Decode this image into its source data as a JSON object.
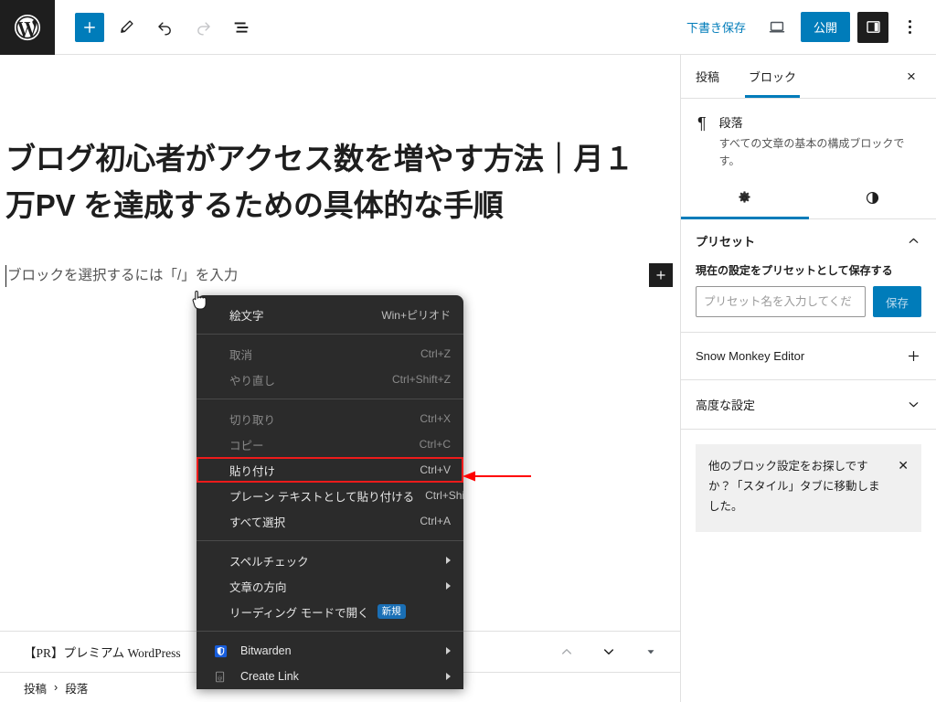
{
  "header": {
    "logo_icon": "wordpress-logo-icon",
    "left_tools": [
      {
        "name": "add-block-button",
        "icon": "plus-icon",
        "label": "ブロックを追加",
        "state": "primary"
      },
      {
        "name": "edit-tool-button",
        "icon": "pencil-icon",
        "label": "ツール",
        "state": "normal"
      },
      {
        "name": "undo-button",
        "icon": "undo-icon",
        "label": "取り消し",
        "state": "normal"
      },
      {
        "name": "redo-button",
        "icon": "redo-icon",
        "label": "やり直し",
        "state": "disabled"
      },
      {
        "name": "details-button",
        "icon": "document-overview-icon",
        "label": "詳細",
        "state": "normal"
      }
    ],
    "save_draft_label": "下書き保存",
    "preview_icon": "laptop-preview-icon",
    "publish_label": "公開",
    "sidebar_toggle_icon": "sidebar-panel-icon",
    "options_icon": "vertical-dots-icon"
  },
  "editor": {
    "post_title": "ブログ初心者がアクセス数を増やす方法｜月１万PV を達成するための具体的な手順",
    "paragraph_placeholder": "ブロックを選択するには「/」を入力",
    "appender_icon": "plus-icon"
  },
  "bottom_bar": {
    "note": "【PR】プレミアム WordPress",
    "arrows": [
      {
        "name": "move-up-button",
        "icon": "chevron-up-icon"
      },
      {
        "name": "move-down-button",
        "icon": "chevron-down-icon"
      },
      {
        "name": "more-options-button",
        "icon": "caret-down-icon"
      }
    ],
    "breadcrumb": [
      "投稿",
      "段落"
    ],
    "breadcrumb_separator": "›"
  },
  "sidebar": {
    "tabs": [
      {
        "label": "投稿",
        "active": false
      },
      {
        "label": "ブロック",
        "active": true
      }
    ],
    "close_icon": "close-icon",
    "close_label": "×",
    "block_card": {
      "icon": "paragraph-pilcrow-icon",
      "icon_glyph": "¶",
      "title": "段落",
      "description": "すべての文章の基本の構成ブロックです。"
    },
    "icon_tabs": [
      {
        "name": "settings-tab",
        "icon": "gear-icon",
        "active": true
      },
      {
        "name": "styles-tab",
        "icon": "contrast-icon",
        "active": false
      }
    ],
    "preset_panel": {
      "title": "プリセット",
      "chevron": "chevron-up-icon",
      "field_label": "現在の設定をプリセットとして保存する",
      "input_placeholder": "プリセット名を入力してくだ",
      "input_value": "",
      "save_label": "保存"
    },
    "snow_monkey_panel": {
      "title": "Snow Monkey Editor",
      "icon": "plus-icon"
    },
    "advanced_panel": {
      "title": "高度な設定",
      "chevron": "chevron-down-icon"
    },
    "notice": {
      "text": "他のブロック設定をお探しですか？「スタイル」タブに移動しました。",
      "close_icon": "close-icon",
      "close_label": "✕"
    }
  },
  "context_menu": {
    "groups": [
      {
        "items": [
          {
            "label": "絵文字",
            "accel": "Win+ピリオド",
            "state": "normal",
            "name": "menu-item-emoji"
          }
        ]
      },
      {
        "items": [
          {
            "label": "取消",
            "accel": "Ctrl+Z",
            "state": "disabled",
            "name": "menu-item-undo"
          },
          {
            "label": "やり直し",
            "accel": "Ctrl+Shift+Z",
            "state": "disabled",
            "name": "menu-item-redo"
          }
        ]
      },
      {
        "items": [
          {
            "label": "切り取り",
            "accel": "Ctrl+X",
            "state": "disabled",
            "name": "menu-item-cut"
          },
          {
            "label": "コピー",
            "accel": "Ctrl+C",
            "state": "disabled",
            "name": "menu-item-copy"
          },
          {
            "label": "貼り付け",
            "accel": "Ctrl+V",
            "state": "highlighted",
            "name": "menu-item-paste"
          },
          {
            "label": "プレーン テキストとして貼り付ける",
            "accel": "Ctrl+Shift+V",
            "state": "normal",
            "name": "menu-item-paste-plain"
          },
          {
            "label": "すべて選択",
            "accel": "Ctrl+A",
            "state": "normal",
            "name": "menu-item-select-all"
          }
        ]
      },
      {
        "items": [
          {
            "label": "スペルチェック",
            "accel": "",
            "submenu": true,
            "state": "normal",
            "name": "menu-item-spellcheck"
          },
          {
            "label": "文章の方向",
            "accel": "",
            "submenu": true,
            "state": "normal",
            "name": "menu-item-writing-direction"
          },
          {
            "label": "リーディング モードで開く",
            "accel": "",
            "badge": "新規",
            "state": "normal",
            "name": "menu-item-reading-mode"
          }
        ]
      },
      {
        "items": [
          {
            "label": "Bitwarden",
            "accel": "",
            "submenu": true,
            "icon": "bitwarden-shield-icon",
            "state": "normal",
            "name": "menu-item-bitwarden"
          },
          {
            "label": "Create Link",
            "accel": "",
            "submenu": true,
            "icon": "create-link-icon",
            "state": "normal",
            "name": "menu-item-create-link"
          }
        ]
      }
    ]
  },
  "annotation": {
    "arrow_color": "#ff0000",
    "highlight_color": "#ee1b1b",
    "points_to": "menu-item-paste"
  },
  "colors": {
    "accent": "#007cba",
    "dark": "#1e1e1e",
    "menu_bg": "#2b2b2b",
    "border": "#e0e0e0"
  }
}
